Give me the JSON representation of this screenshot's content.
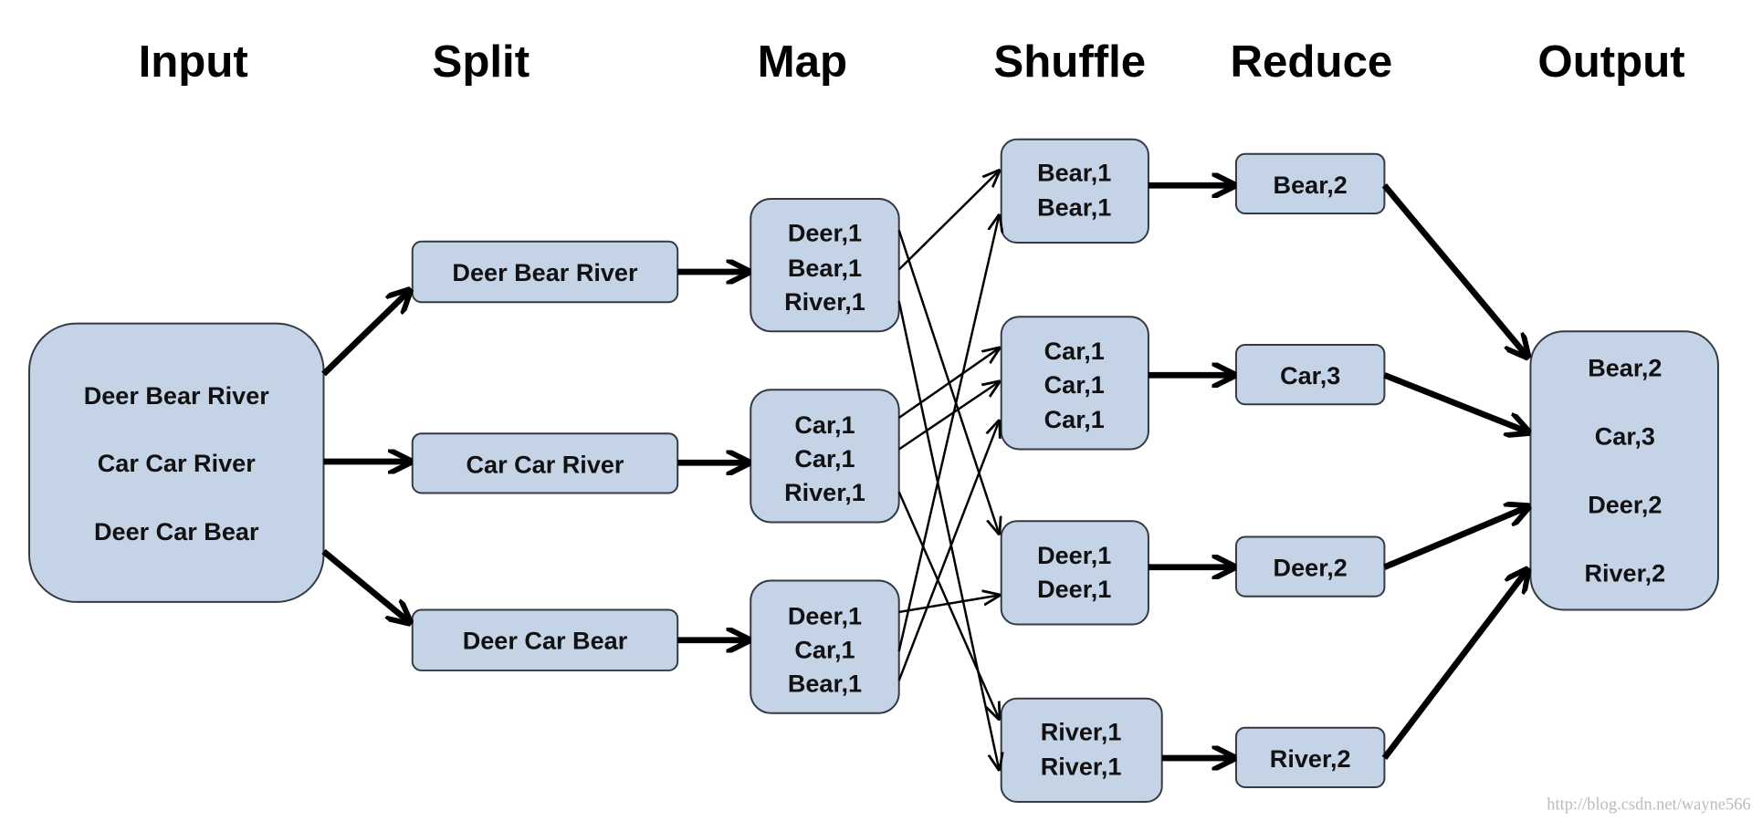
{
  "headers": {
    "input": "Input",
    "split": "Split",
    "map": "Map",
    "shuffle": "Shuffle",
    "reduce": "Reduce",
    "output": "Output"
  },
  "input": [
    "Deer Bear River",
    "Car Car River",
    "Deer Car Bear"
  ],
  "split": [
    "Deer Bear River",
    "Car Car River",
    "Deer Car Bear"
  ],
  "map": [
    [
      "Deer,1",
      "Bear,1",
      "River,1"
    ],
    [
      "Car,1",
      "Car,1",
      "River,1"
    ],
    [
      "Deer,1",
      "Car,1",
      "Bear,1"
    ]
  ],
  "shuffle": [
    [
      "Bear,1",
      "Bear,1"
    ],
    [
      "Car,1",
      "Car,1",
      "Car,1"
    ],
    [
      "Deer,1",
      "Deer,1"
    ],
    [
      "River,1",
      "River,1"
    ]
  ],
  "reduce": [
    "Bear,2",
    "Car,3",
    "Deer,2",
    "River,2"
  ],
  "output": [
    "Bear,2",
    "Car,3",
    "Deer,2",
    "River,2"
  ],
  "watermark": "http://blog.csdn.net/wayne566",
  "colors": {
    "box_fill": "#c5d3e6",
    "box_stroke": "#333a44",
    "arrow": "#000000"
  }
}
